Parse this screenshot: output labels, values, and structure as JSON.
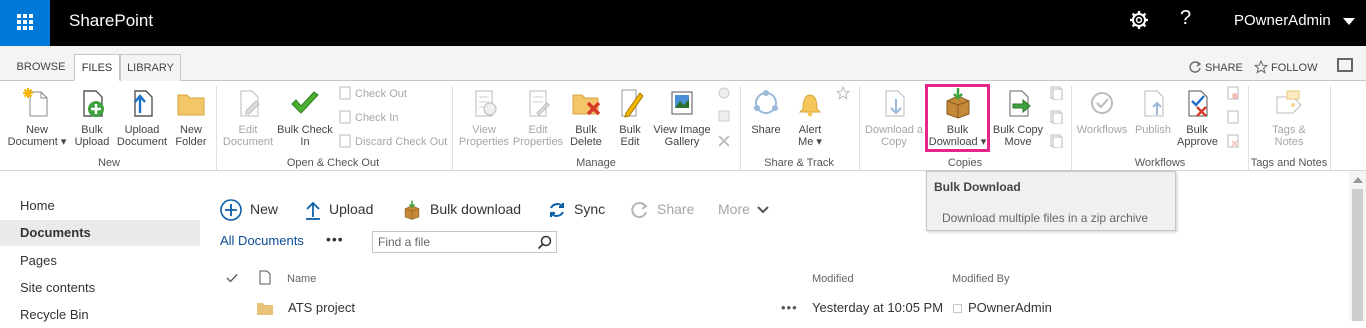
{
  "suite": {
    "app_name": "SharePoint",
    "user": "POwnerAdmin"
  },
  "tabs": [
    "BROWSE",
    "FILES",
    "LIBRARY"
  ],
  "top_actions": {
    "share": "SHARE",
    "follow": "FOLLOW"
  },
  "ribbon": {
    "new": {
      "new_document": "New\nDocument",
      "bulk_upload": "Bulk\nUpload",
      "upload_document": "Upload\nDocument",
      "new_folder": "New\nFolder",
      "label": "New"
    },
    "open_checkout": {
      "edit_document": "Edit\nDocument",
      "bulk_check_in": "Bulk Check\nIn",
      "check_out": "Check Out",
      "check_in": "Check In",
      "discard_check_out": "Discard Check Out",
      "label": "Open & Check Out"
    },
    "manage": {
      "view_properties": "View\nProperties",
      "edit_properties": "Edit\nProperties",
      "bulk_delete": "Bulk\nDelete",
      "bulk_edit": "Bulk\nEdit",
      "view_image_gallery": "View Image\nGallery",
      "label": "Manage"
    },
    "share_track": {
      "share": "Share",
      "alert_me": "Alert\nMe",
      "label": "Share & Track"
    },
    "copies": {
      "download_copy": "Download a\nCopy",
      "bulk_download": "Bulk\nDownload",
      "bulk_copy_move": "Bulk Copy\nMove",
      "label": "Copies"
    },
    "workflows": {
      "workflows": "Workflows",
      "publish": "Publish",
      "bulk_approve": "Bulk\nApprove",
      "label": "Workflows"
    },
    "tags_notes": {
      "tags_notes": "Tags &\nNotes",
      "label": "Tags and Notes"
    }
  },
  "tooltip": {
    "title": "Bulk Download",
    "description": "Download multiple files in a zip archive"
  },
  "left_nav": [
    "Home",
    "Documents",
    "Pages",
    "Site contents",
    "Recycle Bin"
  ],
  "command_bar": {
    "new": "New",
    "upload": "Upload",
    "bulk_download": "Bulk download",
    "sync": "Sync",
    "share": "Share",
    "more": "More"
  },
  "view": {
    "name": "All Documents",
    "search_placeholder": "Find a file"
  },
  "list": {
    "columns": {
      "name": "Name",
      "modified": "Modified",
      "modified_by": "Modified By"
    },
    "rows": [
      {
        "name": "ATS project",
        "modified": "Yesterday at 10:05 PM",
        "modified_by": "POwnerAdmin"
      }
    ]
  },
  "colors": {
    "suite_bar": "#000000",
    "waffle": "#0078d7",
    "highlight": "#e4268a",
    "link": "#0b4b96"
  }
}
